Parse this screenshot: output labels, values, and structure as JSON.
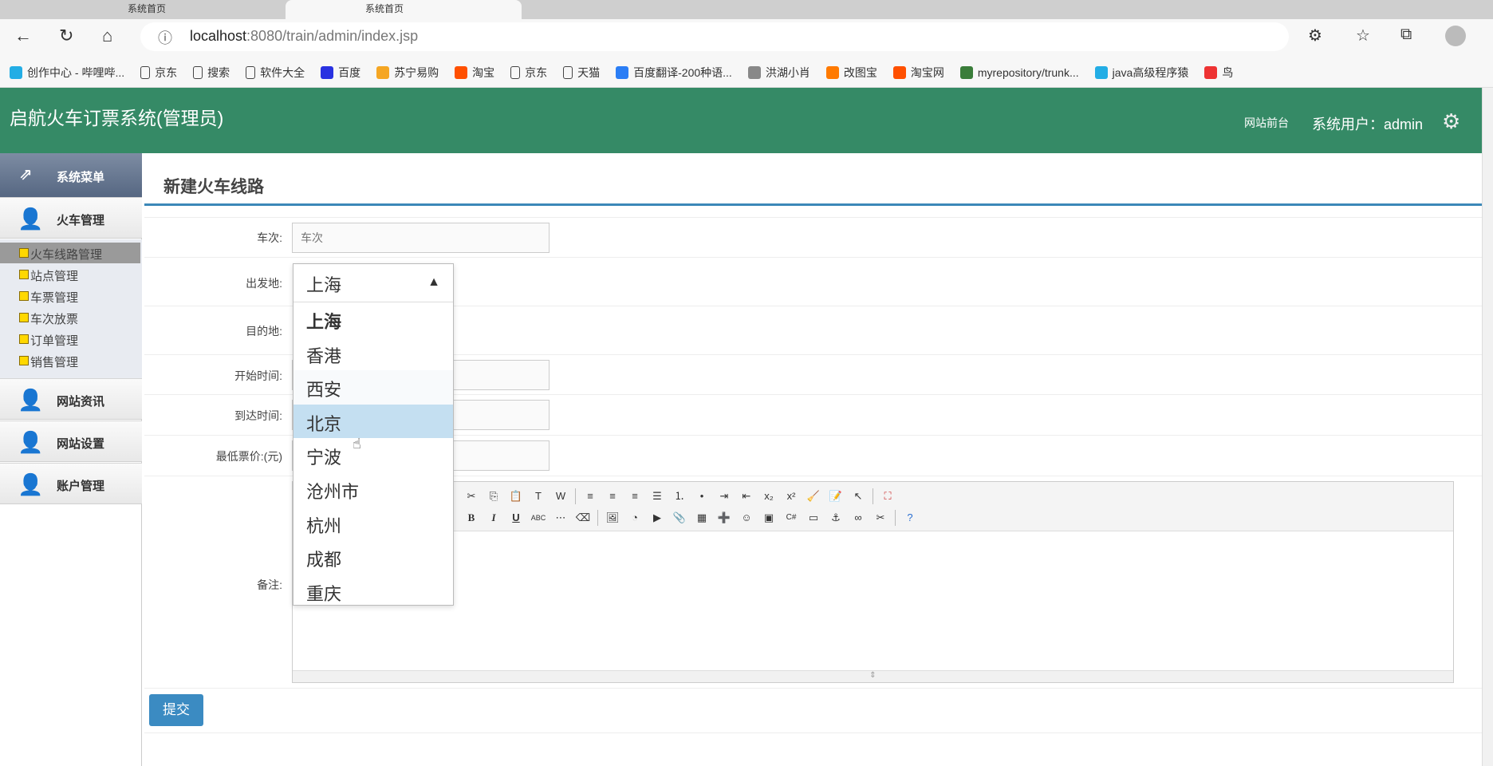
{
  "browser": {
    "tabs": [
      "系统首页",
      "系统首页"
    ],
    "url_host": "localhost",
    "url_rest": ":8080/train/admin/index.jsp",
    "bookmarks": [
      {
        "label": "创作中心 - 哔哩哔...",
        "color": "#23ade5"
      },
      {
        "label": "京东",
        "color": ""
      },
      {
        "label": "搜索",
        "color": ""
      },
      {
        "label": "软件大全",
        "color": ""
      },
      {
        "label": "百度",
        "color": "#2932e1"
      },
      {
        "label": "苏宁易购",
        "color": "#f5a623"
      },
      {
        "label": "淘宝",
        "color": "#ff5000"
      },
      {
        "label": "京东",
        "color": ""
      },
      {
        "label": "天猫",
        "color": ""
      },
      {
        "label": "百度翻译-200种语...",
        "color": "#2b7ef5"
      },
      {
        "label": "洪湖小肖",
        "color": "#888"
      },
      {
        "label": "改图宝",
        "color": "#ff7a00"
      },
      {
        "label": "淘宝网",
        "color": "#ff5000"
      },
      {
        "label": "myrepository/trunk...",
        "color": "#3a7d3a"
      },
      {
        "label": "java高级程序猿",
        "color": "#23ade5"
      },
      {
        "label": "鸟",
        "color": "#e33"
      }
    ]
  },
  "header": {
    "title": "启航火车订票系统(管理员)",
    "front_link": "网站前台",
    "user": "系统用户：admin"
  },
  "sidebar": {
    "head": "系统菜单",
    "groups": [
      "火车管理",
      "网站资讯",
      "网站设置",
      "账户管理"
    ],
    "subitems": [
      "火车线路管理",
      "站点管理",
      "车票管理",
      "车次放票",
      "订单管理",
      "销售管理"
    ]
  },
  "main": {
    "title": "新建火车线路",
    "labels": {
      "train_no": "车次:",
      "from": "出发地:",
      "to": "目的地:",
      "start": "开始时间:",
      "arrive": "到达时间:",
      "price": "最低票价:(元)",
      "remark": "备注:"
    },
    "train_no_placeholder": "车次",
    "from_value": "上海",
    "submit": "提交",
    "options": [
      "上海",
      "香港",
      "西安",
      "北京",
      "宁波",
      "沧州市",
      "杭州",
      "成都",
      "重庆"
    ]
  },
  "colors": {
    "header": "#358a66",
    "accent": "#3b88b8",
    "highlight": "#c4dff1"
  }
}
